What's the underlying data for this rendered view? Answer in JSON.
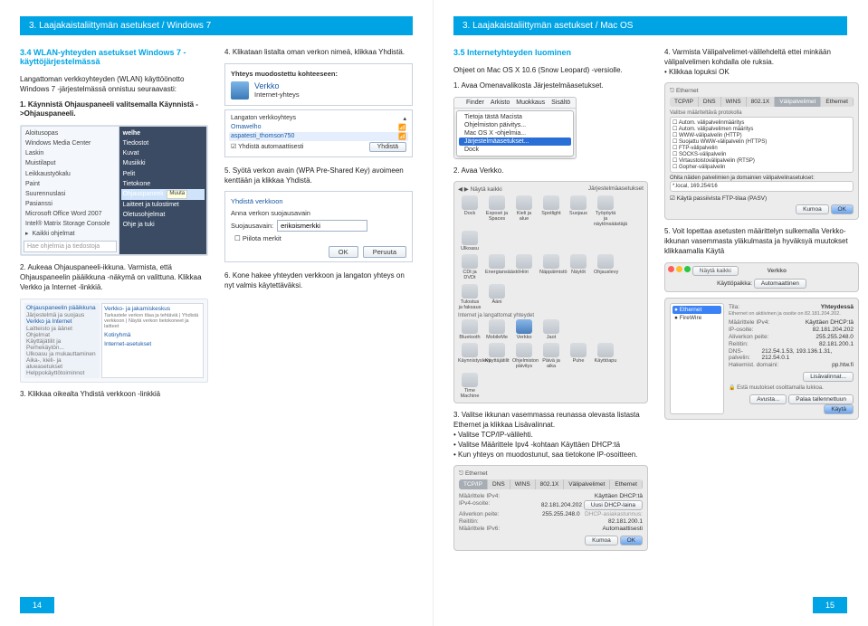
{
  "left_page": {
    "header": "3. Laajakaistaliittymän asetukset / Windows 7",
    "section_title": "3.4 WLAN-yhteyden asetukset Windows 7 -käyttöjärjestelmässä",
    "intro": "Langattoman verkkoyhteyden (WLAN) käyttöönotto Windows 7 -järjestelmässä onnistuu seuraavasti:",
    "steps": {
      "s1": "1. Käynnistä Ohjauspaneeli valitsemalla Käynnistä ->Ohjauspaneeli.",
      "s2": "2. Aukeaa Ohjauspaneeli-ikkuna. Varmista, että Ohjauspaneelin pääikkuna -näkymä on valittuna. Klikkaa Verkko ja Internet -linkkiä.",
      "s3": "3. Klikkaa oikealta Yhdistä verkkoon -linkkiä",
      "s4": "4. Klikataan listalta oman verkon nimeä, klikkaa Yhdistä.",
      "s5": "5. Syötä verkon avain (WPA Pre-Shared Key) avoimeen kenttään ja klikkaa Yhdistä.",
      "s6": "6. Kone hakee yhteyden verkkoon ja langaton yhteys on nyt valmis käytettäväksi."
    },
    "start_menu": {
      "items": [
        "Aloitusopas",
        "Windows Media Center",
        "Laskin",
        "Muistilaput",
        "Leikkaustyökalu",
        "Paint",
        "Suurennuslasi",
        "Pasianssi",
        "Microsoft Office Word 2007",
        "Intel® Matrix Storage Console",
        "Kaikki ohjelmat"
      ],
      "right": [
        "welhe",
        "Tiedostot",
        "Kuvat",
        "Musiikki",
        "Pelit",
        "Tietokone",
        "Ohjauspaneeli",
        "Laitteet ja tulostimet",
        "Oletusohjelmat",
        "Ohje ja tuki"
      ],
      "search": "Hae ohjelmia ja tiedostoja",
      "muuta": "Muuta"
    },
    "cp": {
      "side_title": "Ohjauspaneelin pääikkuna",
      "side_items": [
        "Järjestelmä ja suojaus",
        "Verkko ja Internet",
        "Laitteisto ja äänet",
        "Ohjelmat",
        "Käyttäjätilit ja Perhekäytön...",
        "Ulkoasu ja mukauttaminen",
        "Aika-, kieli- ja alueasetukset",
        "Helppokäyttötoiminnot"
      ],
      "main_items": [
        "Verkko- ja jakamiskeskus",
        "Kotiryhmä",
        "Internet-asetukset"
      ],
      "sub": "Tarkastele verkon tilaa ja tehtäviä | Yhdistä verkkoon | Näytä verkon tietokoneet ja laitteet"
    },
    "conn_box": {
      "title": "Yhteys muodostettu kohteeseen:",
      "net": "Verkko",
      "type": "Internet-yhteys"
    },
    "wifi_list": {
      "header": "Langaton verkkoyhteys",
      "items": [
        "Omawelho",
        "aspatesti_thomson750"
      ],
      "auto": "Yhdistä automaattisesti",
      "connect": "Yhdistä"
    },
    "logon": {
      "title": "Yhdistä verkkoon",
      "prompt": "Anna verkon suojausavain",
      "label": "Suojausavain:",
      "value": "erikoismerkki",
      "hide": "Piilota merkit",
      "ok": "OK",
      "cancel": "Peruuta"
    },
    "pagenum": "14"
  },
  "right_page": {
    "header": "3. Laajakaistaliittymän asetukset / Mac OS",
    "section_title": "3.5 Internetyhteyden luominen",
    "subtitle": "Ohjeet on Mac OS X 10.6 (Snow Leopard) -versiolle.",
    "steps": {
      "s1": "1. Avaa Omenavalikosta Järjestelmäasetukset.",
      "s2": "2. Avaa Verkko.",
      "s3p": "3. Valitse ikkunan vasemmassa reunassa olevasta listasta Ethernet ja klikkaa Lisävalinnat.",
      "s3b1": "• Valitse TCP/IP-välilehti.",
      "s3b2": "• Valitse Määrittele Ipv4 -kohtaan Käyttäen DHCP:tä",
      "s3b3": "• Kun yhteys on muodostunut, saa tietokone IP-osoitteen.",
      "s4": "4. Varmista Välipalvelimet-välilehdeltä ettei minkään välipalvelimen kohdalla ole ruksia.",
      "s4b": "• Klikkaa lopuksi OK",
      "s5": "5. Voit lopettaa asetusten määrittelyn sulkemalla Verkko-ikkunan vasemmasta yläkulmasta ja hyväksyä muutokset klikkaamalla Käytä"
    },
    "mac_menu": {
      "bar": [
        "Finder",
        "Arkisto",
        "Muokkaus",
        "Sisältö"
      ],
      "drop": [
        "Tietoja tästä Macista",
        "Ohjelmiston päivitys...",
        "Mac OS X -ohjelmia...",
        "Järjestelmäasetukset...",
        "Dock"
      ]
    },
    "prefs": {
      "title": "Järjestelmäasetukset",
      "back": "Näytä kaikki",
      "groups": {
        "g1": [
          "Dock",
          "Exposé ja Spaces",
          "Kieli ja alue",
          "Spotlight",
          "Suojaus",
          "Työpöytä ja näytönsäästäjä",
          "Ulkoasu"
        ],
        "g2": [
          "CDt ja DVDt",
          "Energiansäästö",
          "Hiiri",
          "Näppäimistö",
          "Näytöt",
          "Ohjauslevy",
          "Tulostus ja faksaus",
          "Ääni"
        ],
        "g3_hdr": "Internet ja langattomat yhteydet",
        "g3": [
          "Bluetooth",
          "MobileMe",
          "Verkko",
          "Jaot"
        ],
        "g4": [
          "Käynnistyslevy",
          "Käyttäjätilit",
          "Ohjelmiston päivitys",
          "Päivä ja aika",
          "Puhe",
          "Käyttöapu",
          "Time Machine"
        ]
      }
    },
    "netwin": {
      "title": "Verkko",
      "back": "Näytä kaikki",
      "side": [
        "Ethernet",
        "FireWire"
      ],
      "status_lbl": "Tila:",
      "status_val": "Yhteydessä",
      "status_sub": "Ethernet on aktiivinen ja osoite on 82.181.204.202.",
      "rows": {
        "conf": "Määrittele IPv4:",
        "conf_v": "Käyttäen DHCP:tä",
        "ip": "IP-osoite:",
        "ip_v": "82.181.204.202",
        "mask": "Aliverkon peite:",
        "mask_v": "255.255.248.0",
        "gw": "Reititin:",
        "gw_v": "82.181.200.1",
        "dns": "DNS-palvelin:",
        "dns_v": "212.54.1.53, 193.136.1.31, 212.54.0.1",
        "dom": "Hakemist. domaini:",
        "dom_v": "pp.htw.fi"
      },
      "adv": "Lisävalinnat...",
      "lock": "Estä muutokset osoittamalla lukkoa.",
      "help": "Avusta...",
      "revert": "Palaa tallennettuun",
      "apply": "Käytä"
    },
    "advwin": {
      "eth": "Ethernet",
      "tabs": [
        "TCP/IP",
        "DNS",
        "WINS",
        "802.1X",
        "Välipalvelimet",
        "Ethernet"
      ],
      "rows": {
        "v4": "Määrittele IPv4:",
        "v4v": "Käyttäen DHCP:tä",
        "ip": "IPv4-osoite:",
        "ipv": "82.181.204.202",
        "mask": "Aliverkon peite:",
        "maskv": "255.255.248.0",
        "gw": "Reititin:",
        "gwv": "82.181.200.1",
        "v6": "Määrittele IPv6:",
        "v6v": "Automaattisesti",
        "btn_lease": "Uusi DHCP-laina",
        "dhcpid": "DHCP-asiakastunnus:"
      },
      "cancel": "Kumoa",
      "ok": "OK"
    },
    "proxy": {
      "hdr": "Valitse määriteltävä protokolla",
      "items": [
        "Autom. välipalvelinmääritys",
        "Autom. välipalvelimen määritys",
        "WWW-välipalvelin (HTTP)",
        "Suojattu WWW-välipalvelin (HTTPS)",
        "FTP-välipalvelin",
        "SOCKS-välipalvelin",
        "Virtaustoistovälipalvelin (RTSP)",
        "Gopher-välipalvelin"
      ],
      "pasv": "Käytä passiivista FTP-tilaa (PASV)",
      "bypass": "Ohita näiden palvelimien ja domainien välipalvelinasetukset:",
      "local": "*.local, 169.254/16",
      "cancel": "Kumoa",
      "ok": "OK"
    },
    "netwin_bottom": {
      "title": "Verkko",
      "back": "Näytä kaikki",
      "loc": "Käyttöpaikka:",
      "loc_v": "Automaattinen"
    },
    "pagenum": "15"
  }
}
